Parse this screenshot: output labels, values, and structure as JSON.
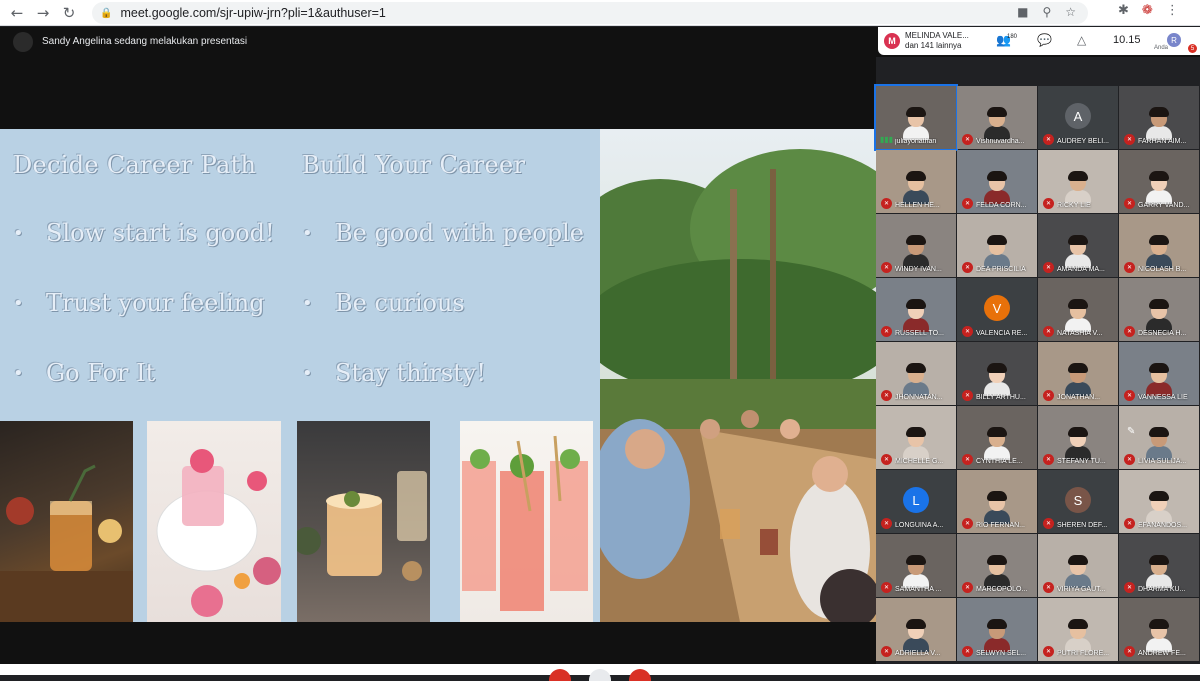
{
  "browser": {
    "url": "meet.google.com/sjr-upiw-jrn?pli=1&authuser=1",
    "nav": {
      "back_icon": "back-arrow-icon",
      "forward_icon": "forward-arrow-icon",
      "reload_icon": "reload-icon"
    }
  },
  "meet": {
    "presenting_text": "Sandy Angelina sedang melakukan presentasi",
    "owner": {
      "initial": "M",
      "name": "MELINDA VALE...",
      "others": "dan 141 lainnya"
    },
    "participant_count": "180",
    "time": "10.15",
    "self": {
      "initial": "R",
      "label": "Anda",
      "badge": "5"
    },
    "colors": {
      "accent_red": "#d93025",
      "mute_red": "#c5221f",
      "brand_blue": "#1a73e8"
    }
  },
  "slide": {
    "left_column": {
      "title": "Decide Career Path",
      "bullets": [
        "Slow start is good!",
        "Trust your feeling",
        "Go For It"
      ]
    },
    "right_column": {
      "title": "Build Your Career",
      "bullets": [
        "Be good with people",
        "Be curious",
        "Stay thirsty!"
      ]
    }
  },
  "participants": [
    {
      "name": "juliayonathan",
      "type": "video",
      "speaking": true
    },
    {
      "name": "Vishnuvardha...",
      "type": "video"
    },
    {
      "name": "AUDREY BELI...",
      "type": "initial",
      "initial": "A",
      "color": "#5f6368"
    },
    {
      "name": "FARHAN AIM...",
      "type": "video"
    },
    {
      "name": "HELLEN HE...",
      "type": "video"
    },
    {
      "name": "FELDA CORN...",
      "type": "video"
    },
    {
      "name": "RICKY LIE",
      "type": "video"
    },
    {
      "name": "GARRY VAND...",
      "type": "video"
    },
    {
      "name": "WINDY IVAN...",
      "type": "video"
    },
    {
      "name": "DEA PRISCILIA",
      "type": "video"
    },
    {
      "name": "AMANDA MA...",
      "type": "video"
    },
    {
      "name": "NICOLASH B...",
      "type": "video"
    },
    {
      "name": "RUSSELL TO...",
      "type": "video"
    },
    {
      "name": "VALENCIA RE...",
      "type": "initial",
      "initial": "V",
      "color": "#e8710a"
    },
    {
      "name": "NATASHIA V...",
      "type": "video"
    },
    {
      "name": "DESNECIA H...",
      "type": "video"
    },
    {
      "name": "JHONNATAN...",
      "type": "video"
    },
    {
      "name": "BILLY ARTHU...",
      "type": "video"
    },
    {
      "name": "JONATHAN...",
      "type": "video"
    },
    {
      "name": "VANNESSA LIE",
      "type": "video"
    },
    {
      "name": "MICHELLE G...",
      "type": "video"
    },
    {
      "name": "CYNTHIA LE...",
      "type": "video"
    },
    {
      "name": "STEFANY TU...",
      "type": "video"
    },
    {
      "name": "LIVIA SULIJA...",
      "type": "video",
      "hover": true
    },
    {
      "name": "LONGUINA A...",
      "type": "initial",
      "initial": "L",
      "color": "#1a73e8"
    },
    {
      "name": "RIO FERNAN...",
      "type": "video"
    },
    {
      "name": "SHEREN DEF...",
      "type": "initial",
      "initial": "S",
      "color": "#795548"
    },
    {
      "name": "EFANANDOS...",
      "type": "video"
    },
    {
      "name": "SAMANTHA ...",
      "type": "video"
    },
    {
      "name": "MARCOPOLO...",
      "type": "video"
    },
    {
      "name": "VIRIYA GAUT...",
      "type": "video"
    },
    {
      "name": "DHARMA KU...",
      "type": "video"
    },
    {
      "name": "ADRIELLA V...",
      "type": "video"
    },
    {
      "name": "SELWYN SEL...",
      "type": "video"
    },
    {
      "name": "PUTRI FLORE...",
      "type": "video"
    },
    {
      "name": "ANDREW FE...",
      "type": "video"
    }
  ]
}
